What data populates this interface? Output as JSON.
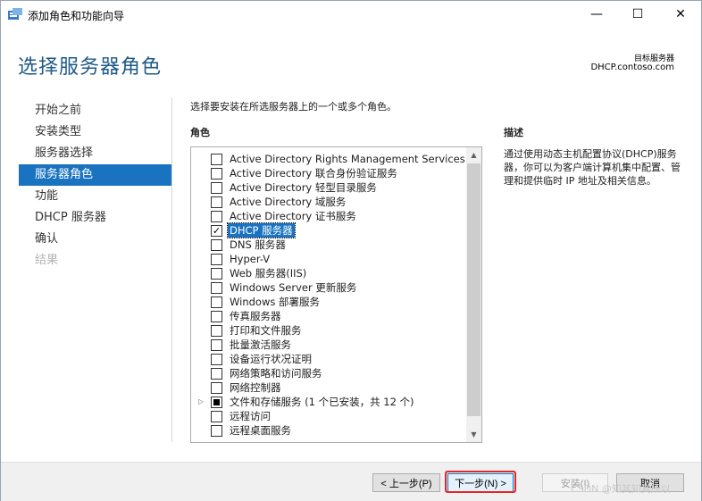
{
  "window": {
    "title": "添加角色和功能向导",
    "min_glyph": "—",
    "max_glyph": "☐",
    "close_glyph": "✕"
  },
  "header": {
    "page_title": "选择服务器角色",
    "target_label": "目标服务器",
    "target_value": "DHCP.contoso.com"
  },
  "nav": {
    "items": [
      {
        "label": "开始之前",
        "state": "normal"
      },
      {
        "label": "安装类型",
        "state": "normal"
      },
      {
        "label": "服务器选择",
        "state": "normal"
      },
      {
        "label": "服务器角色",
        "state": "active"
      },
      {
        "label": "功能",
        "state": "normal"
      },
      {
        "label": "DHCP 服务器",
        "state": "normal"
      },
      {
        "label": "确认",
        "state": "normal"
      },
      {
        "label": "结果",
        "state": "disabled"
      }
    ]
  },
  "main": {
    "instruction": "选择要安装在所选服务器上的一个或多个角色。",
    "roles_header": "角色",
    "roles": [
      {
        "label": "Active Directory Rights Management Services",
        "checked": "unchecked"
      },
      {
        "label": "Active Directory 联合身份验证服务",
        "checked": "unchecked"
      },
      {
        "label": "Active Directory 轻型目录服务",
        "checked": "unchecked"
      },
      {
        "label": "Active Directory 域服务",
        "checked": "unchecked"
      },
      {
        "label": "Active Directory 证书服务",
        "checked": "unchecked"
      },
      {
        "label": "DHCP 服务器",
        "checked": "checked",
        "selected": true
      },
      {
        "label": "DNS 服务器",
        "checked": "unchecked"
      },
      {
        "label": "Hyper-V",
        "checked": "unchecked"
      },
      {
        "label": "Web 服务器(IIS)",
        "checked": "unchecked"
      },
      {
        "label": "Windows Server 更新服务",
        "checked": "unchecked"
      },
      {
        "label": "Windows 部署服务",
        "checked": "unchecked"
      },
      {
        "label": "传真服务器",
        "checked": "unchecked"
      },
      {
        "label": "打印和文件服务",
        "checked": "unchecked"
      },
      {
        "label": "批量激活服务",
        "checked": "unchecked"
      },
      {
        "label": "设备运行状况证明",
        "checked": "unchecked"
      },
      {
        "label": "网络策略和访问服务",
        "checked": "unchecked"
      },
      {
        "label": "网络控制器",
        "checked": "unchecked"
      },
      {
        "label": "文件和存储服务 (1 个已安装，共 12 个)",
        "checked": "partial",
        "expandable": true
      },
      {
        "label": "远程访问",
        "checked": "unchecked"
      },
      {
        "label": "远程桌面服务",
        "checked": "unchecked"
      }
    ],
    "description_header": "描述",
    "description_text": "通过使用动态主机配置协议(DHCP)服务器，你可以为客户端计算机集中配置、管理和提供临时 IP 地址及相关信息。"
  },
  "footer": {
    "prev_label": "< 上一步(P)",
    "next_label": "下一步(N) >",
    "install_label": "安装(I)",
    "cancel_label": "取消",
    "watermark": "CSDN @知其知其所以"
  },
  "colors": {
    "accent": "#1a73c0",
    "title_blue": "#1f5a87",
    "highlight_red": "#e32626"
  }
}
